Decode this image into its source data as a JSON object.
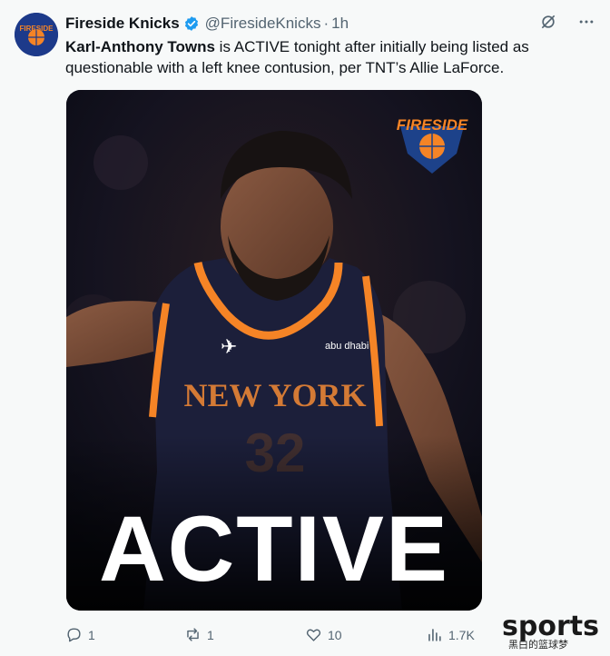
{
  "account": {
    "name": "Fireside Knicks",
    "handle": "@FiresideKnicks",
    "separator": "·",
    "time": "1h",
    "avatar_text": "FIRESIDE"
  },
  "tweet": {
    "player_name": "Karl-Anthony Towns",
    "text_rest": " is ACTIVE tonight after initially being listed as questionable with a left knee contusion, per TNT’s Allie LaForce."
  },
  "media": {
    "logo_text": "FIRESIDE",
    "jersey_text": "NEW YORK",
    "jersey_number": "32",
    "sponsor_text": "abu dhabi",
    "overlay_text": "ACTIVE"
  },
  "actions": {
    "replies": "1",
    "reposts": "1",
    "likes": "10",
    "views": "1.7K"
  },
  "watermark": {
    "brand": "sports",
    "sub": "黑白的篮球梦"
  },
  "colors": {
    "knicks_orange": "#f58426",
    "knicks_blue": "#1d428a",
    "verified_blue": "#1d9bf0",
    "muted_text": "#536471"
  }
}
